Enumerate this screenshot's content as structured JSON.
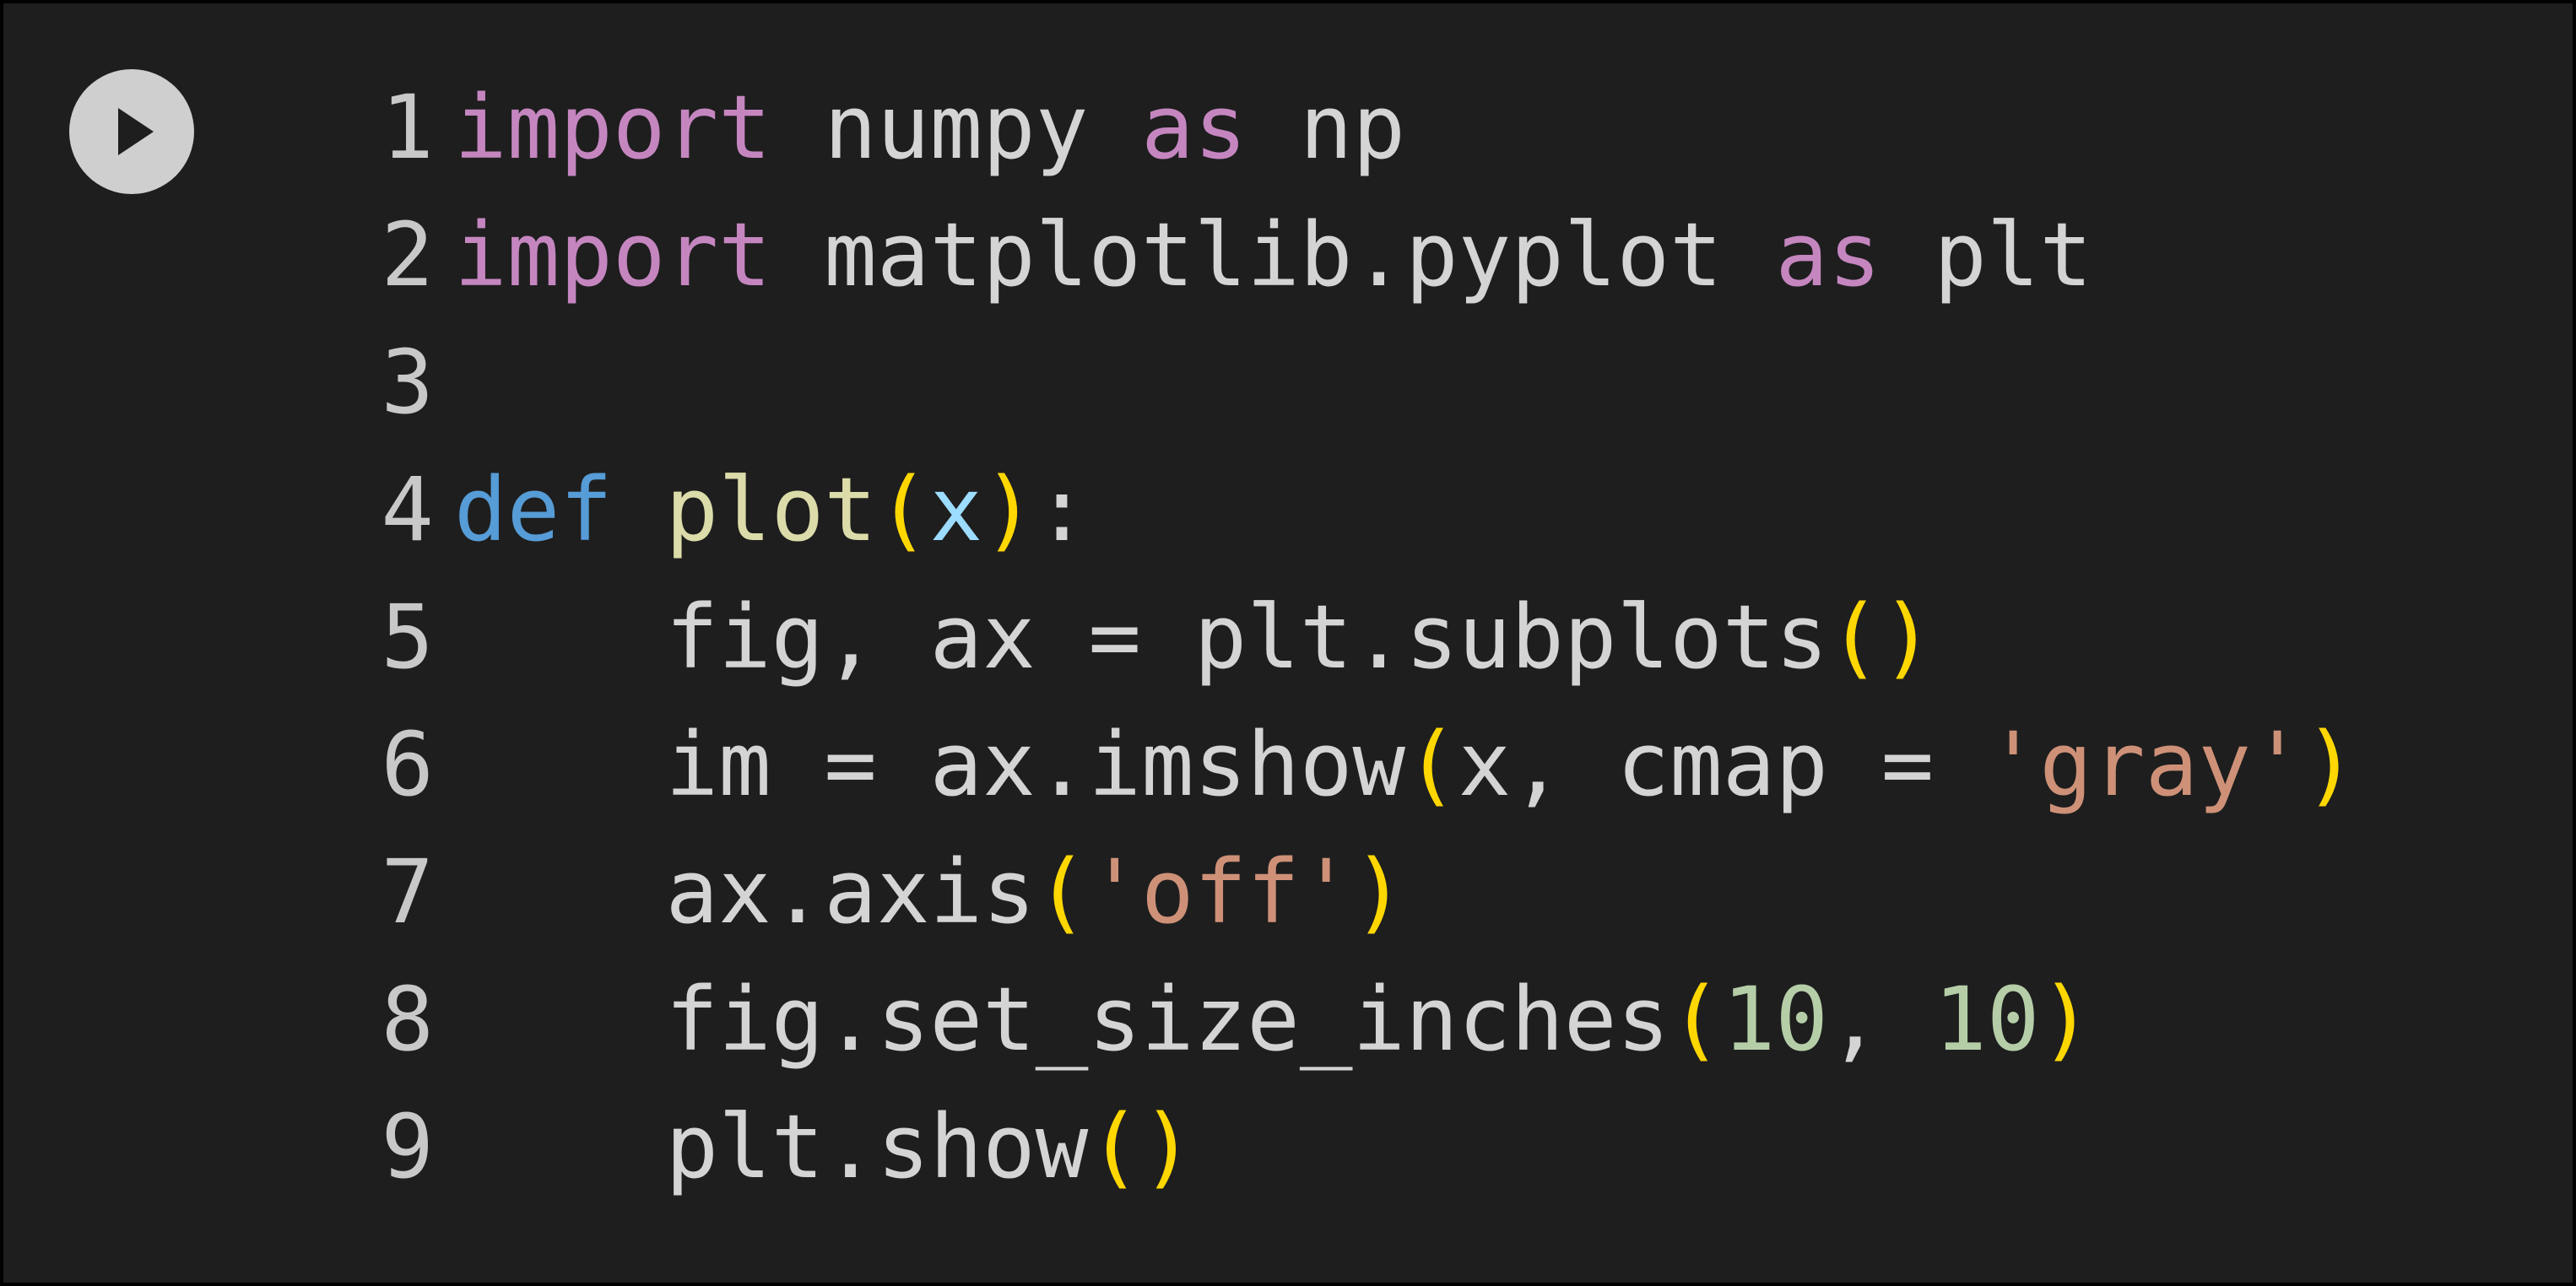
{
  "colors": {
    "background": "#1e1e1e",
    "run_button": "#cfcfcf",
    "keyword": "#c586c0",
    "def_keyword": "#569cd6",
    "function": "#dcdcaa",
    "parameter": "#9cdcfe",
    "bracket": "#ffd700",
    "string": "#ce9178",
    "number": "#b5cea8",
    "text": "#d4d4d4"
  },
  "run_button": {
    "icon": "play-icon"
  },
  "code": {
    "lines": [
      {
        "n": "1",
        "tokens": [
          {
            "t": "import",
            "c": "kw"
          },
          {
            "t": " numpy ",
            "c": "txt"
          },
          {
            "t": "as",
            "c": "kw"
          },
          {
            "t": " np",
            "c": "txt"
          }
        ]
      },
      {
        "n": "2",
        "tokens": [
          {
            "t": "import",
            "c": "kw"
          },
          {
            "t": " matplotlib.pyplot ",
            "c": "txt"
          },
          {
            "t": "as",
            "c": "kw"
          },
          {
            "t": " plt",
            "c": "txt"
          }
        ]
      },
      {
        "n": "3",
        "tokens": []
      },
      {
        "n": "4",
        "tokens": [
          {
            "t": "def",
            "c": "def"
          },
          {
            "t": " ",
            "c": "txt"
          },
          {
            "t": "plot",
            "c": "fn"
          },
          {
            "t": "(",
            "c": "br"
          },
          {
            "t": "x",
            "c": "par"
          },
          {
            "t": ")",
            "c": "br"
          },
          {
            "t": ":",
            "c": "txt"
          }
        ]
      },
      {
        "n": "5",
        "tokens": [
          {
            "t": "    fig, ax = plt.subplots",
            "c": "txt"
          },
          {
            "t": "()",
            "c": "br"
          }
        ]
      },
      {
        "n": "6",
        "tokens": [
          {
            "t": "    im = ax.imshow",
            "c": "txt"
          },
          {
            "t": "(",
            "c": "br"
          },
          {
            "t": "x, cmap = ",
            "c": "txt"
          },
          {
            "t": "'gray'",
            "c": "str"
          },
          {
            "t": ")",
            "c": "br"
          }
        ]
      },
      {
        "n": "7",
        "tokens": [
          {
            "t": "    ax.axis",
            "c": "txt"
          },
          {
            "t": "(",
            "c": "br"
          },
          {
            "t": "'off'",
            "c": "str"
          },
          {
            "t": ")",
            "c": "br"
          }
        ]
      },
      {
        "n": "8",
        "tokens": [
          {
            "t": "    fig.set_size_inches",
            "c": "txt"
          },
          {
            "t": "(",
            "c": "br"
          },
          {
            "t": "10",
            "c": "num"
          },
          {
            "t": ", ",
            "c": "txt"
          },
          {
            "t": "10",
            "c": "num"
          },
          {
            "t": ")",
            "c": "br"
          }
        ]
      },
      {
        "n": "9",
        "tokens": [
          {
            "t": "    plt.show",
            "c": "txt"
          },
          {
            "t": "()",
            "c": "br"
          }
        ]
      }
    ]
  }
}
